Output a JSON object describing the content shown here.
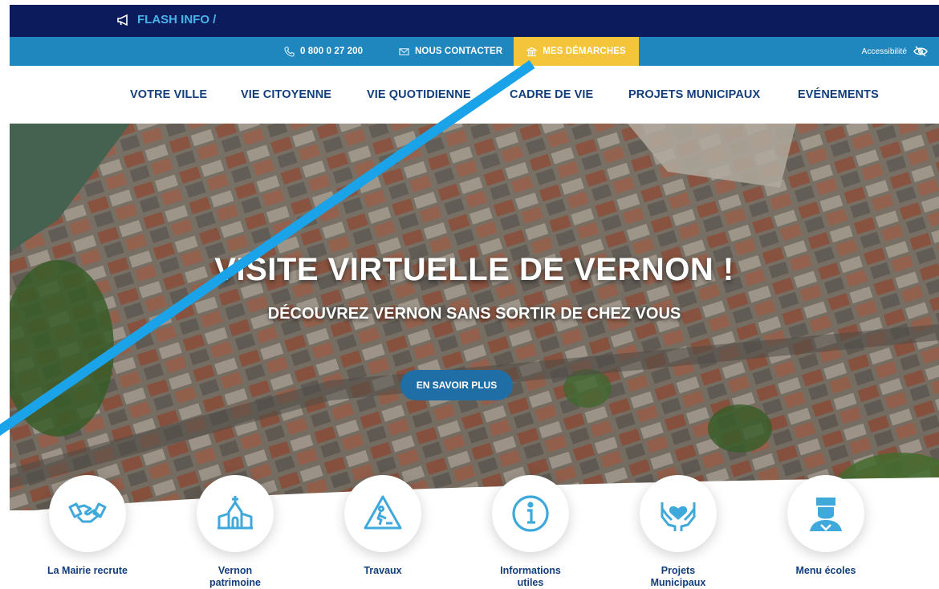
{
  "flash": {
    "label": "FLASH INFO /"
  },
  "utility": {
    "phone": "0 800 0 27 200",
    "contact": "NOUS CONTACTER",
    "demarches": "MES DÉMARCHES",
    "accessibility": "Accessibilité"
  },
  "nav": {
    "items": [
      "VOTRE VILLE",
      "VIE CITOYENNE",
      "VIE QUOTIDIENNE",
      "CADRE DE VIE",
      "PROJETS MUNICIPAUX",
      "EVÉNEMENTS"
    ]
  },
  "hero": {
    "title": "VISITE VIRTUELLE DE VERNON !",
    "subtitle": "DÉCOUVREZ VERNON SANS SORTIR DE CHEZ VOUS",
    "button": "EN SAVOIR PLUS"
  },
  "quicklinks": [
    {
      "label": "La Mairie recrute",
      "icon": "handshake-icon"
    },
    {
      "label": "Vernon patrimoine",
      "icon": "church-icon"
    },
    {
      "label": "Travaux",
      "icon": "roadwork-icon"
    },
    {
      "label": "Informations utiles",
      "icon": "info-icon"
    },
    {
      "label": "Projets Municipaux",
      "icon": "heart-hands-icon"
    },
    {
      "label": "Menu écoles",
      "icon": "chef-icon"
    }
  ],
  "colors": {
    "navy": "#0b1b5c",
    "utility_blue": "#1f87be",
    "accent_yellow": "#f4c43a",
    "nav_text": "#123f7c",
    "icon_blue": "#3fa9dc",
    "annotation": "#1aa3e8"
  }
}
